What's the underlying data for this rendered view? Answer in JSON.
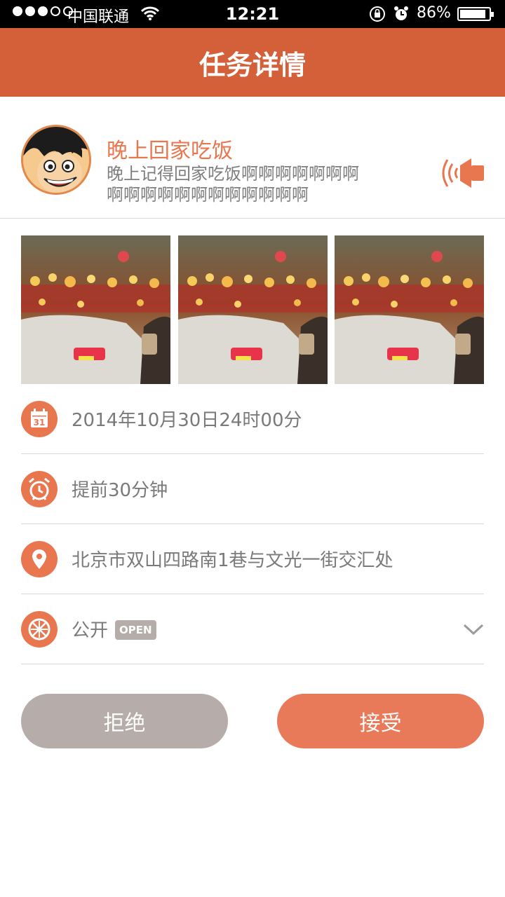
{
  "status_bar": {
    "carrier": "中国联通",
    "time": "12:21",
    "battery": "86%"
  },
  "nav": {
    "title": "任务详情"
  },
  "task": {
    "title": "晚上回家吃饭",
    "description_line1": "晚上记得回家吃饭啊啊啊啊啊啊啊",
    "description_line2": "啊啊啊啊啊啊啊啊啊啊啊啊"
  },
  "details": {
    "datetime": "2014年10月30日24时00分",
    "calendar_day": "31",
    "reminder": "提前30分钟",
    "location": "北京市双山四路南1巷与文光一街交汇处",
    "visibility": "公开",
    "visibility_badge": "OPEN"
  },
  "actions": {
    "reject": "拒绝",
    "accept": "接受"
  },
  "colors": {
    "accent": "#d4603a",
    "accent_light": "#e8764f",
    "reject_bg": "#b6adaa"
  },
  "icons": [
    "calendar-icon",
    "alarm-clock-icon",
    "location-pin-icon",
    "globe-icon",
    "speaker-icon",
    "chevron-down-icon"
  ]
}
